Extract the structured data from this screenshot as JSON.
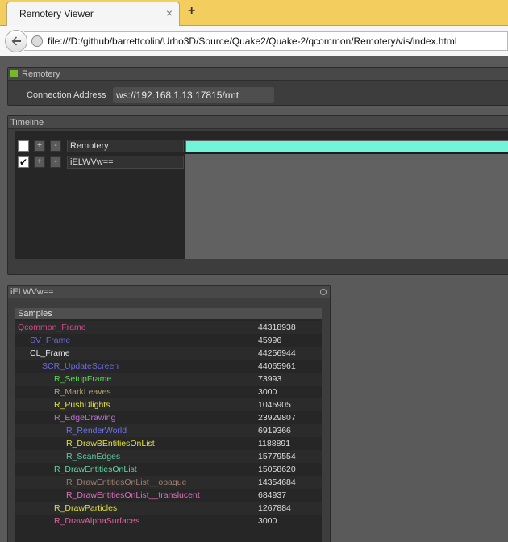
{
  "browser": {
    "tab_title": "Remotery Viewer",
    "tab_close": "×",
    "new_tab": "+",
    "url": "file:///D:/github/barrettcolin/Urho3D/Source/Quake2/Quake-2/qcommon/Remotery/vis/index.html"
  },
  "connection": {
    "title": "Remotery",
    "status_color": "#76b82a",
    "address_label": "Connection Address",
    "address_value": "ws://192.168.1.13:17815/rmt"
  },
  "timeline": {
    "title": "Timeline",
    "plus": "+",
    "minus": "-",
    "rows": [
      {
        "name": "Remotery",
        "checked": false
      },
      {
        "name": "iELWVw==",
        "checked": true
      }
    ],
    "bar_color": "#70f5d9"
  },
  "sample_window": {
    "title": "iELWVw==",
    "header": "Samples",
    "samples": [
      {
        "name": "Qcommon_Frame",
        "value": "44318938",
        "depth": 0,
        "color": "#d14a8a"
      },
      {
        "name": "SV_Frame",
        "value": "45996",
        "depth": 1,
        "color": "#6a6ae0"
      },
      {
        "name": "CL_Frame",
        "value": "44256944",
        "depth": 1,
        "color": "#e8e8e8"
      },
      {
        "name": "SCR_UpdateScreen",
        "value": "44065961",
        "depth": 2,
        "color": "#6a6ae0"
      },
      {
        "name": "R_SetupFrame",
        "value": "73993",
        "depth": 3,
        "color": "#5fd35f"
      },
      {
        "name": "R_MarkLeaves",
        "value": "3000",
        "depth": 3,
        "color": "#b0a070"
      },
      {
        "name": "R_PushDlights",
        "value": "1045905",
        "depth": 3,
        "color": "#e0e040"
      },
      {
        "name": "R_EdgeDrawing",
        "value": "23929807",
        "depth": 3,
        "color": "#c070d8"
      },
      {
        "name": "R_RenderWorld",
        "value": "6919366",
        "depth": 4,
        "color": "#7070e8"
      },
      {
        "name": "R_DrawBEntitiesOnList",
        "value": "1188891",
        "depth": 4,
        "color": "#e0e040"
      },
      {
        "name": "R_ScanEdges",
        "value": "15779554",
        "depth": 4,
        "color": "#60c8a0"
      },
      {
        "name": "R_DrawEntitiesOnList",
        "value": "15058620",
        "depth": 3,
        "color": "#60d8a0"
      },
      {
        "name": "R_DrawEntitiesOnList__opaque",
        "value": "14354684",
        "depth": 4,
        "color": "#a08070"
      },
      {
        "name": "R_DrawEntitiesOnList__translucent",
        "value": "684937",
        "depth": 4,
        "color": "#e070c0"
      },
      {
        "name": "R_DrawParticles",
        "value": "1267884",
        "depth": 3,
        "color": "#e0e040"
      },
      {
        "name": "R_DrawAlphaSurfaces",
        "value": "3000",
        "depth": 3,
        "color": "#e060a0"
      }
    ]
  }
}
